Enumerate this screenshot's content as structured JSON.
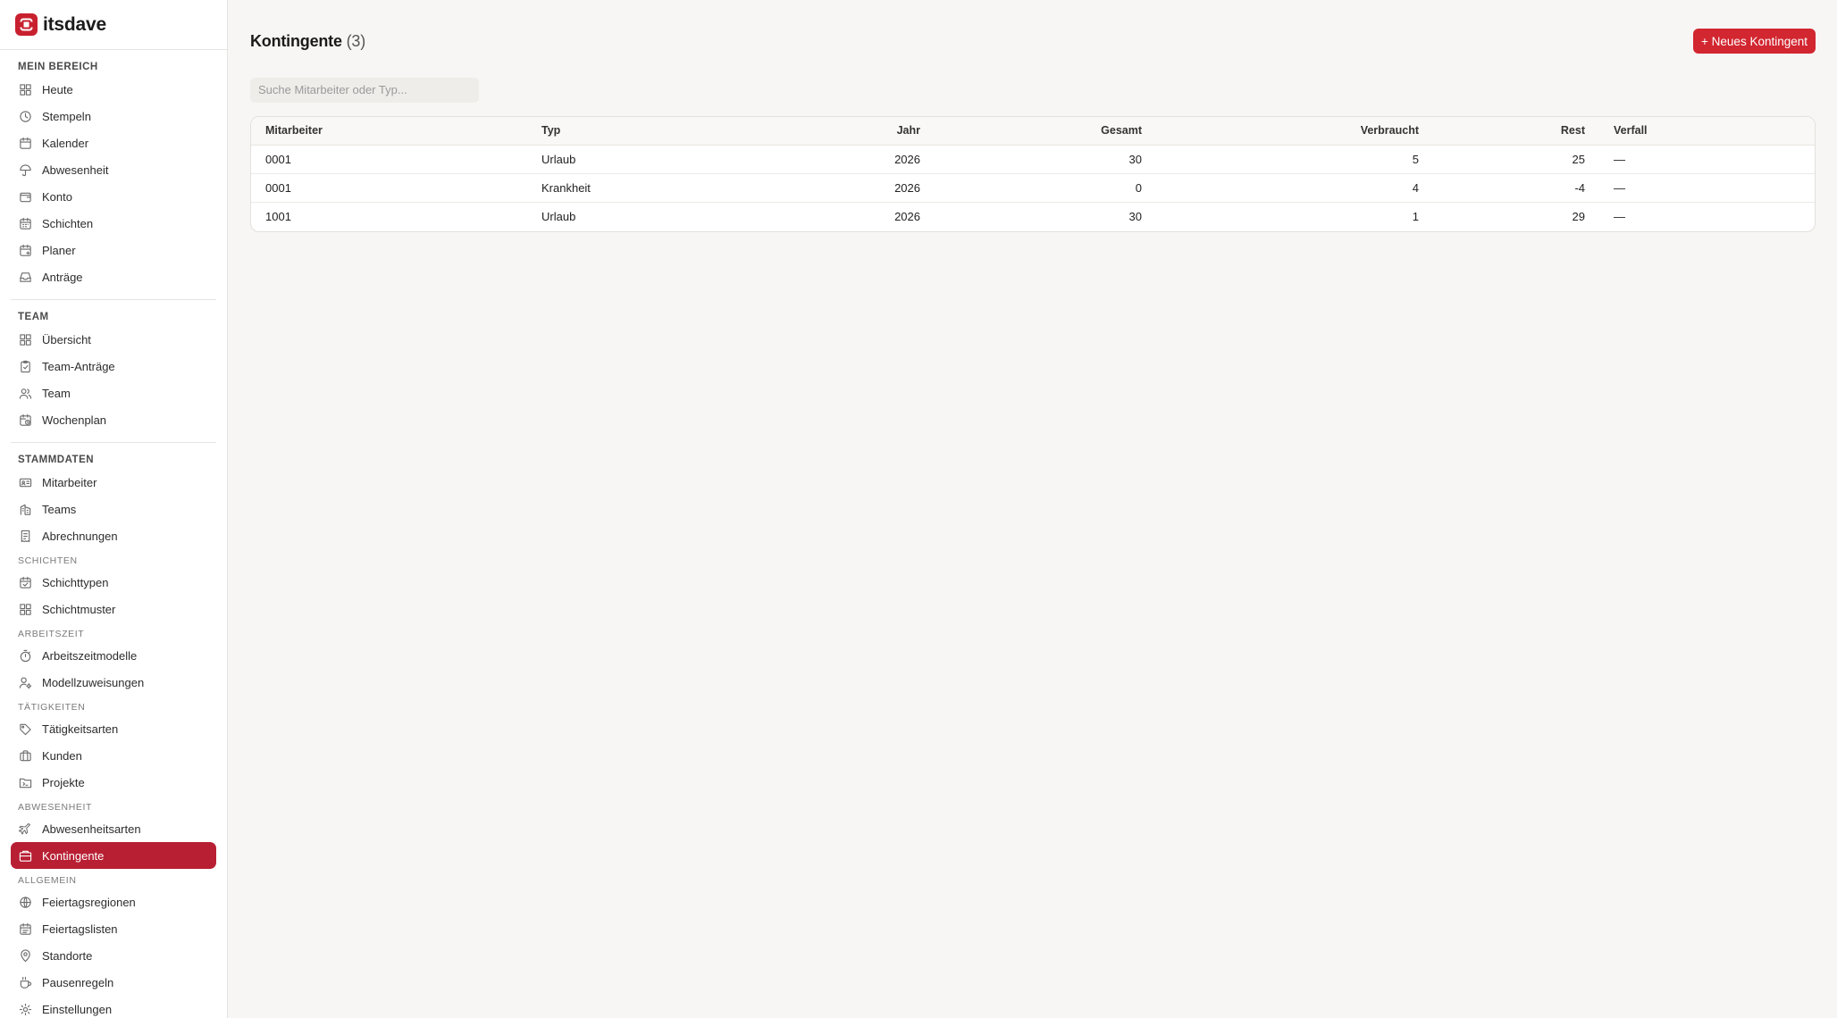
{
  "brand": {
    "name": "itsdave"
  },
  "sidebar": {
    "sections": [
      {
        "title": "Mein Bereich",
        "items": [
          {
            "label": "Heute",
            "icon": "grid-icon"
          },
          {
            "label": "Stempeln",
            "icon": "clock-icon"
          },
          {
            "label": "Kalender",
            "icon": "calendar-icon"
          },
          {
            "label": "Abwesenheit",
            "icon": "umbrella-icon"
          },
          {
            "label": "Konto",
            "icon": "wallet-icon"
          },
          {
            "label": "Schichten",
            "icon": "calendar-days-icon"
          },
          {
            "label": "Planer",
            "icon": "calendar-plus-icon"
          },
          {
            "label": "Anträge",
            "icon": "inbox-icon"
          }
        ]
      },
      {
        "title": "Team",
        "items": [
          {
            "label": "Übersicht",
            "icon": "grid-icon"
          },
          {
            "label": "Team-Anträge",
            "icon": "clipboard-icon"
          },
          {
            "label": "Team",
            "icon": "users-icon"
          },
          {
            "label": "Wochenplan",
            "icon": "calendar-clock-icon"
          }
        ]
      },
      {
        "title": "Stammdaten",
        "items": [
          {
            "label": "Mitarbeiter",
            "icon": "id-card-icon"
          },
          {
            "label": "Teams",
            "icon": "building-icon"
          },
          {
            "label": "Abrechnungen",
            "icon": "receipt-icon"
          }
        ],
        "subsections": [
          {
            "title": "Schichten",
            "items": [
              {
                "label": "Schichttypen",
                "icon": "calendar-check-icon"
              },
              {
                "label": "Schichtmuster",
                "icon": "grid-icon"
              }
            ]
          },
          {
            "title": "Arbeitszeit",
            "items": [
              {
                "label": "Arbeitszeitmodelle",
                "icon": "timer-icon"
              },
              {
                "label": "Modellzuweisungen",
                "icon": "user-cog-icon"
              }
            ]
          },
          {
            "title": "Tätigkeiten",
            "items": [
              {
                "label": "Tätigkeitsarten",
                "icon": "tag-icon"
              },
              {
                "label": "Kunden",
                "icon": "briefcase-icon"
              },
              {
                "label": "Projekte",
                "icon": "folder-icon"
              }
            ]
          },
          {
            "title": "Abwesenheit",
            "items": [
              {
                "label": "Abwesenheitsarten",
                "icon": "plane-icon"
              },
              {
                "label": "Kontingente",
                "icon": "ticket-icon",
                "active": true
              }
            ]
          },
          {
            "title": "Allgemein",
            "items": [
              {
                "label": "Feiertagsregionen",
                "icon": "globe-icon"
              },
              {
                "label": "Feiertagslisten",
                "icon": "calendar-list-icon"
              },
              {
                "label": "Standorte",
                "icon": "map-pin-icon"
              },
              {
                "label": "Pausenregeln",
                "icon": "coffee-icon"
              },
              {
                "label": "Einstellungen",
                "icon": "gear-icon"
              }
            ]
          }
        ]
      }
    ]
  },
  "page": {
    "title": "Kontingente",
    "count": "(3)",
    "new_button": "+ Neues Kontingent",
    "search_placeholder": "Suche Mitarbeiter oder Typ..."
  },
  "table": {
    "headers": [
      "Mitarbeiter",
      "Typ",
      "Jahr",
      "Gesamt",
      "Verbraucht",
      "Rest",
      "Verfall"
    ],
    "rows": [
      [
        "0001",
        "Urlaub",
        "2026",
        "30",
        "5",
        "25",
        "—"
      ],
      [
        "0001",
        "Krankheit",
        "2026",
        "0",
        "4",
        "-4",
        "—"
      ],
      [
        "1001",
        "Urlaub",
        "2026",
        "30",
        "1",
        "29",
        "—"
      ]
    ]
  },
  "colors": {
    "accent": "#b81f33",
    "button": "#d22630"
  }
}
